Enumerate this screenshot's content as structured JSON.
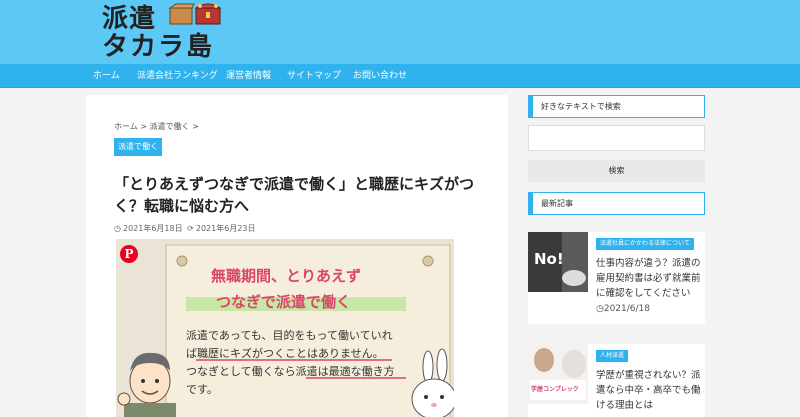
{
  "header": {
    "logo_line1": "派遣",
    "logo_line2": "タカラ島"
  },
  "nav": {
    "items": [
      "ホーム",
      "派遣会社ランキング",
      "運営者情報",
      "サイトマップ",
      "お問い合わせ"
    ]
  },
  "article": {
    "breadcrumb": "ホーム > 派遣で働く >",
    "category": "派遣で働く",
    "title": "「とりあえずつなぎで派遣で働く」と職歴にキズがつく？転職に悩む方へ",
    "posted": "2021年6月18日",
    "updated": "2021年6月23日",
    "eyecatch": {
      "heading_line1": "無職期間、とりあえず",
      "heading_line2": "つなぎで派遣で働く",
      "body_line1": "派遣であっても、目的をもって働いていれ",
      "body_line2": "ば職歴にキズがつくことはありません。",
      "body_line3": "つなぎとして働くなら派遣は最適な働き方",
      "body_line4": "です。"
    }
  },
  "sidebar": {
    "search_heading": "好きなテキストで検索",
    "search_button": "検索",
    "recent_heading": "最新記事",
    "posts": [
      {
        "tag": "派遣社員にかかわる法律について",
        "title": "仕事内容が違う？派遣の雇用契約書は必ず就業前に確認をしてください",
        "date": "2021/6/18",
        "thumb_text": "No!"
      },
      {
        "tag": "人材派遣",
        "title": "学歴が重視されない？派遣なら中卒・高卒でも働ける理由とは",
        "thumb_text": "学歴コンプレック"
      }
    ]
  },
  "colors": {
    "header_bg": "#5bc8f5",
    "nav_bg": "#2fb2ed",
    "accent": "#2fb2ed"
  }
}
